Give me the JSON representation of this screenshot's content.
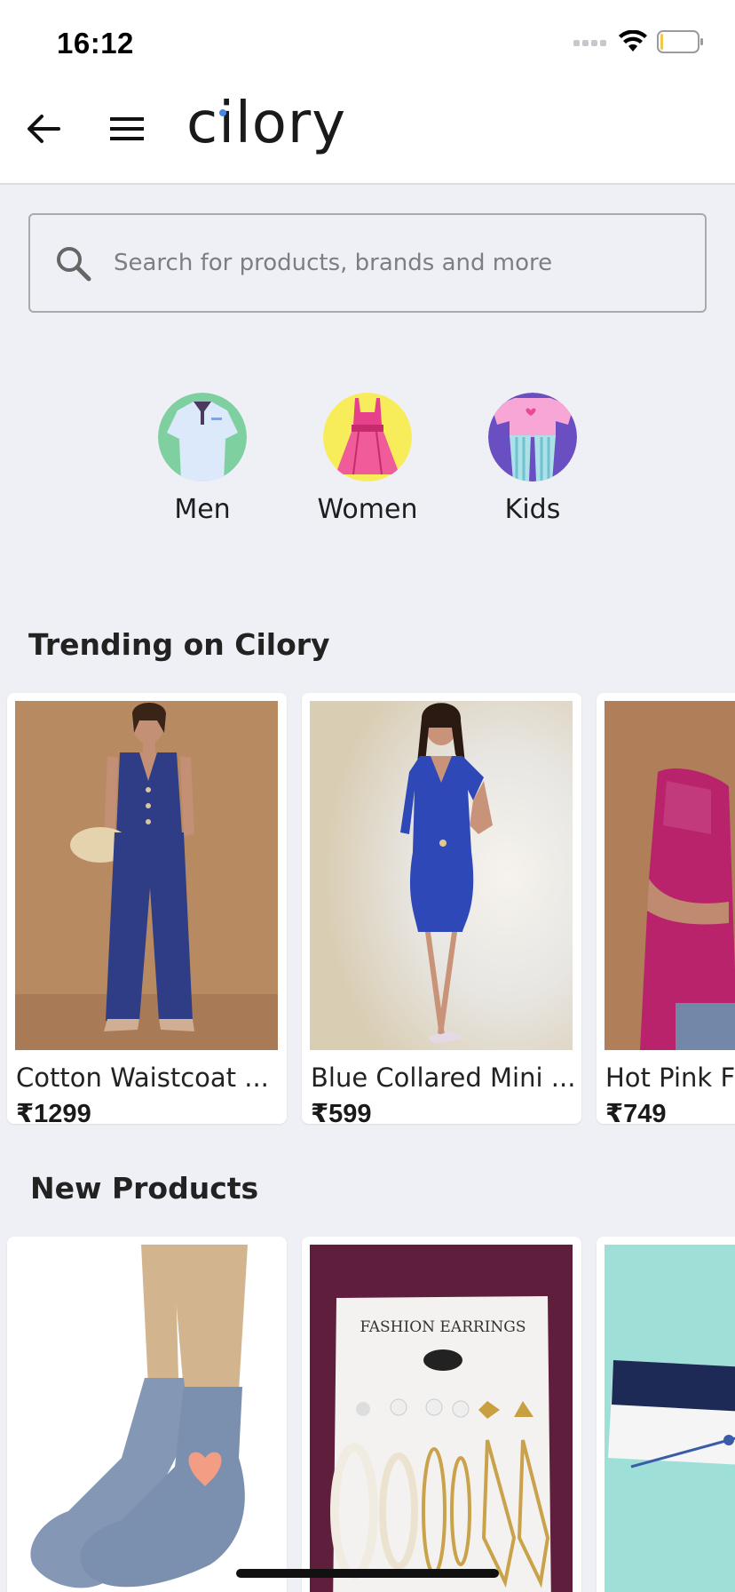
{
  "status_bar": {
    "time": "16:12"
  },
  "header": {
    "logo": "cilory"
  },
  "search": {
    "placeholder": "Search for products, brands and more"
  },
  "categories": [
    {
      "label": "Men",
      "icon": "shirt-icon"
    },
    {
      "label": "Women",
      "icon": "dress-icon"
    },
    {
      "label": "Kids",
      "icon": "kids-clothes-icon"
    }
  ],
  "trending": {
    "title": "Trending on Cilory",
    "products": [
      {
        "name": "Cotton Waistcoat ...",
        "price": "₹1299"
      },
      {
        "name": "Blue Collared Mini ...",
        "price": "₹599"
      },
      {
        "name": "Hot Pink F",
        "price": "₹749"
      }
    ]
  },
  "new_products": {
    "title": "New Products",
    "products": [
      {
        "image": "socks"
      },
      {
        "image": "earrings",
        "image_text": "FASHION EARRINGS"
      },
      {
        "image": "bracelet"
      }
    ]
  },
  "colors": {
    "accent": "#4a86e8",
    "background": "#eff0f5"
  }
}
